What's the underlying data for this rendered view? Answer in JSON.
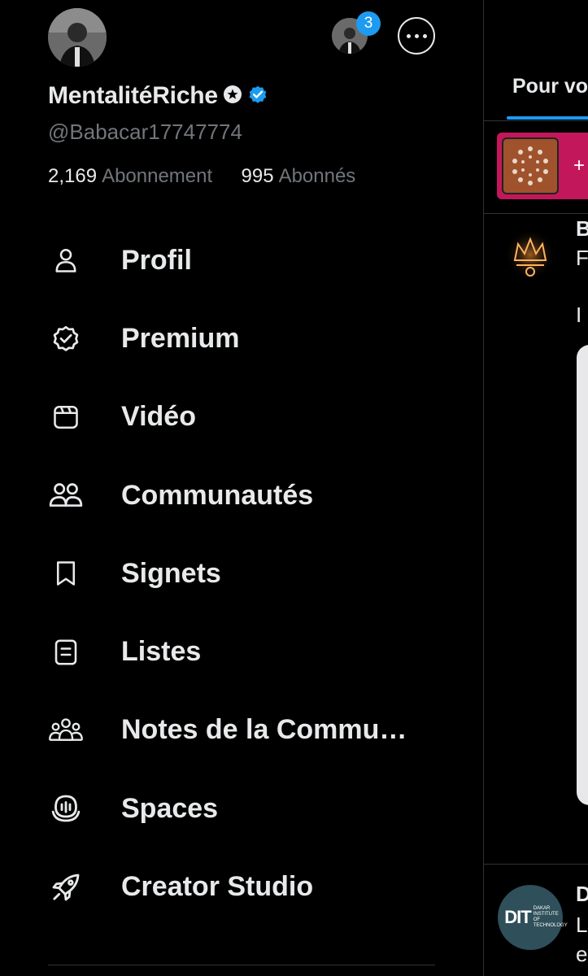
{
  "profile": {
    "display_name": "MentalitéRiche",
    "handle": "@Babacar17747774",
    "following_count": "2,169",
    "following_label": "Abonnement",
    "followers_count": "995",
    "followers_label": "Abonnés",
    "badge_icons": [
      "star-icon",
      "verified-badge-icon"
    ],
    "account_switcher_badge": "3"
  },
  "menu": [
    {
      "label": "Profil",
      "icon": "person-icon"
    },
    {
      "label": "Premium",
      "icon": "premium-badge-icon"
    },
    {
      "label": "Vidéo",
      "icon": "video-icon"
    },
    {
      "label": "Communautés",
      "icon": "communities-icon"
    },
    {
      "label": "Signets",
      "icon": "bookmark-icon"
    },
    {
      "label": "Listes",
      "icon": "lists-icon"
    },
    {
      "label": "Notes de la Commu…",
      "icon": "community-notes-icon"
    },
    {
      "label": "Spaces",
      "icon": "spaces-icon"
    },
    {
      "label": "Creator Studio",
      "icon": "rocket-icon"
    }
  ],
  "background": {
    "active_tab": "Pour vo",
    "banner_plus": "+",
    "post_letters": [
      "B",
      "F",
      "I",
      "D",
      "L",
      "e"
    ],
    "dit_logo_text": "DIT",
    "dit_logo_subtext": "DAKAR INSTITUTE OF TECHNOLOGY"
  },
  "colors": {
    "background": "#000000",
    "primary_text": "#e7e9ea",
    "secondary_text": "#71767b",
    "accent": "#1d9bf0",
    "divider": "#2f3336"
  }
}
